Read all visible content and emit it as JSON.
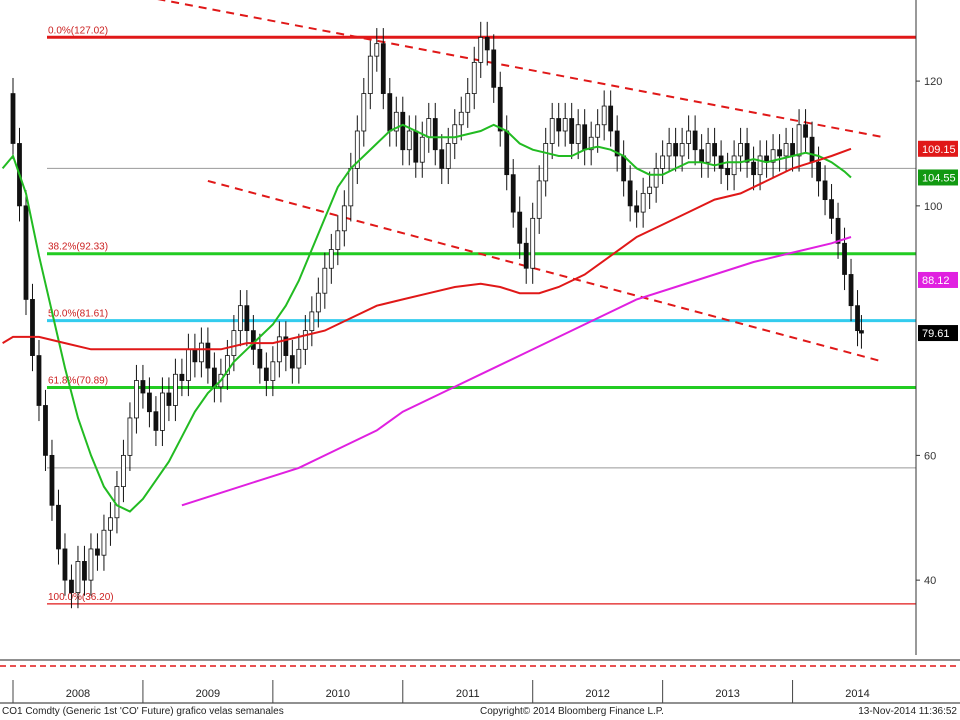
{
  "chart_data": {
    "type": "candlestick",
    "ylim": [
      28,
      133
    ],
    "x_range": [
      2007.9,
      2014.95
    ],
    "y_ticks": [
      "120",
      "100",
      "60",
      "40"
    ],
    "x_ticks": [
      "2008",
      "2009",
      "2010",
      "2011",
      "2012",
      "2013",
      "2014"
    ],
    "fib_levels": [
      {
        "label": "0.0%(127.02)",
        "value": 127.02,
        "color": "#e01818"
      },
      {
        "label": "38.2%(92.33)",
        "value": 92.33,
        "color": "#22cc22"
      },
      {
        "label": "50.0%(81.61)",
        "value": 81.61,
        "color": "#33ccee"
      },
      {
        "label": "61.8%(70.89)",
        "value": 70.89,
        "color": "#22cc22"
      },
      {
        "label": "100.0%(36.20)",
        "value": 36.2,
        "color": "#e01818"
      }
    ],
    "gray_lines": [
      106.0,
      58.0
    ],
    "price_path": [
      [
        2007.92,
        118
      ],
      [
        2008.0,
        110
      ],
      [
        2008.05,
        100
      ],
      [
        2008.1,
        85
      ],
      [
        2008.15,
        76
      ],
      [
        2008.2,
        68
      ],
      [
        2008.25,
        60
      ],
      [
        2008.3,
        52
      ],
      [
        2008.35,
        45
      ],
      [
        2008.4,
        40
      ],
      [
        2008.45,
        38
      ],
      [
        2008.5,
        43
      ],
      [
        2008.55,
        40
      ],
      [
        2008.6,
        45
      ],
      [
        2008.65,
        44
      ],
      [
        2008.7,
        48
      ],
      [
        2008.75,
        50
      ],
      [
        2008.8,
        55
      ],
      [
        2008.85,
        60
      ],
      [
        2008.9,
        66
      ],
      [
        2008.95,
        72
      ],
      [
        2009.0,
        70
      ],
      [
        2009.05,
        67
      ],
      [
        2009.1,
        64
      ],
      [
        2009.15,
        70
      ],
      [
        2009.2,
        68
      ],
      [
        2009.25,
        73
      ],
      [
        2009.3,
        72
      ],
      [
        2009.35,
        77
      ],
      [
        2009.4,
        75
      ],
      [
        2009.45,
        78
      ],
      [
        2009.5,
        74
      ],
      [
        2009.55,
        71
      ],
      [
        2009.6,
        73
      ],
      [
        2009.65,
        76
      ],
      [
        2009.7,
        80
      ],
      [
        2009.75,
        84
      ],
      [
        2009.8,
        80
      ],
      [
        2009.85,
        77
      ],
      [
        2009.9,
        74
      ],
      [
        2009.95,
        72
      ],
      [
        2010.0,
        75
      ],
      [
        2010.05,
        79
      ],
      [
        2010.1,
        76
      ],
      [
        2010.15,
        74
      ],
      [
        2010.2,
        77
      ],
      [
        2010.25,
        80
      ],
      [
        2010.3,
        83
      ],
      [
        2010.35,
        86
      ],
      [
        2010.4,
        90
      ],
      [
        2010.45,
        93
      ],
      [
        2010.5,
        96
      ],
      [
        2010.55,
        100
      ],
      [
        2010.6,
        106
      ],
      [
        2010.65,
        112
      ],
      [
        2010.7,
        118
      ],
      [
        2010.75,
        124
      ],
      [
        2010.8,
        126
      ],
      [
        2010.85,
        118
      ],
      [
        2010.9,
        112
      ],
      [
        2010.95,
        115
      ],
      [
        2011.0,
        109
      ],
      [
        2011.05,
        112
      ],
      [
        2011.1,
        107
      ],
      [
        2011.15,
        111
      ],
      [
        2011.2,
        114
      ],
      [
        2011.25,
        109
      ],
      [
        2011.3,
        106
      ],
      [
        2011.35,
        110
      ],
      [
        2011.4,
        113
      ],
      [
        2011.45,
        115
      ],
      [
        2011.5,
        118
      ],
      [
        2011.55,
        123
      ],
      [
        2011.6,
        127
      ],
      [
        2011.65,
        125
      ],
      [
        2011.7,
        119
      ],
      [
        2011.75,
        112
      ],
      [
        2011.8,
        105
      ],
      [
        2011.85,
        99
      ],
      [
        2011.9,
        94
      ],
      [
        2011.95,
        90
      ],
      [
        2012.0,
        98
      ],
      [
        2012.05,
        104
      ],
      [
        2012.1,
        110
      ],
      [
        2012.15,
        114
      ],
      [
        2012.2,
        112
      ],
      [
        2012.25,
        114
      ],
      [
        2012.3,
        110
      ],
      [
        2012.35,
        113
      ],
      [
        2012.4,
        109
      ],
      [
        2012.45,
        111
      ],
      [
        2012.5,
        113
      ],
      [
        2012.55,
        116
      ],
      [
        2012.6,
        112
      ],
      [
        2012.65,
        108
      ],
      [
        2012.7,
        104
      ],
      [
        2012.75,
        100
      ],
      [
        2012.8,
        99
      ],
      [
        2012.85,
        102
      ],
      [
        2012.9,
        103
      ],
      [
        2012.95,
        106
      ],
      [
        2013.0,
        108
      ],
      [
        2013.05,
        110
      ],
      [
        2013.1,
        108
      ],
      [
        2013.15,
        110
      ],
      [
        2013.2,
        112
      ],
      [
        2013.25,
        109
      ],
      [
        2013.3,
        107
      ],
      [
        2013.35,
        110
      ],
      [
        2013.4,
        108
      ],
      [
        2013.45,
        106
      ],
      [
        2013.5,
        105
      ],
      [
        2013.55,
        108
      ],
      [
        2013.6,
        110
      ],
      [
        2013.65,
        107
      ],
      [
        2013.7,
        105
      ],
      [
        2013.75,
        108
      ],
      [
        2013.8,
        107
      ],
      [
        2013.85,
        109
      ],
      [
        2013.9,
        108
      ],
      [
        2013.95,
        110
      ],
      [
        2014.0,
        108
      ],
      [
        2014.05,
        113
      ],
      [
        2014.1,
        111
      ],
      [
        2014.15,
        107
      ],
      [
        2014.2,
        104
      ],
      [
        2014.25,
        101
      ],
      [
        2014.3,
        98
      ],
      [
        2014.35,
        94
      ],
      [
        2014.4,
        89
      ],
      [
        2014.45,
        84
      ],
      [
        2014.5,
        80
      ],
      [
        2014.53,
        79.61
      ]
    ],
    "moving_averages": [
      {
        "color": "#22bb22",
        "values": [
          [
            2007.92,
            106
          ],
          [
            2008.0,
            108
          ],
          [
            2008.1,
            102
          ],
          [
            2008.2,
            92
          ],
          [
            2008.3,
            83
          ],
          [
            2008.4,
            74
          ],
          [
            2008.5,
            66
          ],
          [
            2008.6,
            60
          ],
          [
            2008.7,
            55
          ],
          [
            2008.8,
            52
          ],
          [
            2008.9,
            51
          ],
          [
            2009.0,
            53
          ],
          [
            2009.1,
            56
          ],
          [
            2009.2,
            59
          ],
          [
            2009.3,
            63
          ],
          [
            2009.4,
            67
          ],
          [
            2009.5,
            70
          ],
          [
            2009.6,
            72
          ],
          [
            2009.7,
            75
          ],
          [
            2009.8,
            77
          ],
          [
            2009.9,
            79
          ],
          [
            2010.0,
            81
          ],
          [
            2010.1,
            84
          ],
          [
            2010.2,
            88
          ],
          [
            2010.3,
            93
          ],
          [
            2010.4,
            98
          ],
          [
            2010.5,
            103
          ],
          [
            2010.6,
            106
          ],
          [
            2010.7,
            108
          ],
          [
            2010.8,
            110
          ],
          [
            2010.9,
            112
          ],
          [
            2011.0,
            113
          ],
          [
            2011.1,
            112
          ],
          [
            2011.2,
            111
          ],
          [
            2011.3,
            111
          ],
          [
            2011.4,
            111
          ],
          [
            2011.5,
            111.5
          ],
          [
            2011.6,
            112
          ],
          [
            2011.7,
            113
          ],
          [
            2011.8,
            112
          ],
          [
            2011.9,
            110
          ],
          [
            2012.0,
            109
          ],
          [
            2012.1,
            108.5
          ],
          [
            2012.2,
            108
          ],
          [
            2012.3,
            108
          ],
          [
            2012.4,
            109
          ],
          [
            2012.5,
            109.5
          ],
          [
            2012.6,
            109
          ],
          [
            2012.7,
            108
          ],
          [
            2012.8,
            106
          ],
          [
            2012.9,
            105
          ],
          [
            2013.0,
            105
          ],
          [
            2013.1,
            106
          ],
          [
            2013.2,
            107
          ],
          [
            2013.3,
            107
          ],
          [
            2013.4,
            106.5
          ],
          [
            2013.5,
            107
          ],
          [
            2013.6,
            107
          ],
          [
            2013.7,
            107.5
          ],
          [
            2013.8,
            107
          ],
          [
            2013.9,
            107.5
          ],
          [
            2014.0,
            108
          ],
          [
            2014.1,
            108.5
          ],
          [
            2014.2,
            108
          ],
          [
            2014.3,
            107
          ],
          [
            2014.4,
            105.5
          ],
          [
            2014.45,
            104.55
          ]
        ]
      },
      {
        "color": "#e01818",
        "values": [
          [
            2007.92,
            78
          ],
          [
            2008.0,
            79
          ],
          [
            2008.2,
            79
          ],
          [
            2008.4,
            78
          ],
          [
            2008.6,
            77
          ],
          [
            2008.8,
            77
          ],
          [
            2009.0,
            77
          ],
          [
            2009.2,
            77
          ],
          [
            2009.4,
            77
          ],
          [
            2009.6,
            77
          ],
          [
            2009.8,
            78
          ],
          [
            2010.0,
            78
          ],
          [
            2010.2,
            79
          ],
          [
            2010.4,
            80
          ],
          [
            2010.6,
            82
          ],
          [
            2010.8,
            84
          ],
          [
            2011.0,
            85
          ],
          [
            2011.2,
            86
          ],
          [
            2011.4,
            87
          ],
          [
            2011.6,
            87.5
          ],
          [
            2011.75,
            87
          ],
          [
            2011.9,
            86
          ],
          [
            2012.05,
            86
          ],
          [
            2012.2,
            87
          ],
          [
            2012.4,
            89
          ],
          [
            2012.6,
            92
          ],
          [
            2012.8,
            95
          ],
          [
            2013.0,
            97
          ],
          [
            2013.2,
            99
          ],
          [
            2013.4,
            101
          ],
          [
            2013.6,
            102
          ],
          [
            2013.8,
            104
          ],
          [
            2014.0,
            106
          ],
          [
            2014.15,
            107
          ],
          [
            2014.3,
            108
          ],
          [
            2014.45,
            109.15
          ]
        ]
      },
      {
        "color": "#e020e0",
        "values": [
          [
            2009.3,
            52
          ],
          [
            2009.6,
            54
          ],
          [
            2009.9,
            56
          ],
          [
            2010.2,
            58
          ],
          [
            2010.5,
            61
          ],
          [
            2010.8,
            64
          ],
          [
            2011.0,
            67
          ],
          [
            2011.3,
            70
          ],
          [
            2011.6,
            73
          ],
          [
            2011.9,
            76
          ],
          [
            2012.2,
            79
          ],
          [
            2012.5,
            82
          ],
          [
            2012.8,
            85
          ],
          [
            2013.1,
            87
          ],
          [
            2013.4,
            89
          ],
          [
            2013.7,
            91
          ],
          [
            2014.0,
            92.5
          ],
          [
            2014.3,
            94
          ],
          [
            2014.45,
            95
          ]
        ]
      }
    ],
    "trendlines": [
      {
        "color": "#e01818",
        "points": [
          [
            2008.9,
            134
          ],
          [
            2014.7,
            111
          ]
        ]
      },
      {
        "color": "#e01818",
        "points": [
          [
            2009.5,
            104
          ],
          [
            2014.7,
            75
          ]
        ]
      }
    ],
    "price_tags": [
      {
        "label": "109.15",
        "value": 109.15,
        "bg": "#e01818",
        "fg": "#ffffff"
      },
      {
        "label": "104.55",
        "value": 104.55,
        "bg": "#119911",
        "fg": "#ffffff"
      },
      {
        "label": "88.12",
        "value": 88.12,
        "bg": "#e020e0",
        "fg": "#ffffff"
      },
      {
        "label": "79.61",
        "value": 79.61,
        "bg": "#000000",
        "fg": "#ffffff"
      }
    ]
  },
  "footer": {
    "left": "CO1 Comdty (Generic 1st 'CO' Future) grafico velas semanales",
    "center": "Copyright© 2014 Bloomberg Finance L.P.",
    "right": "13-Nov-2014 11:36:52"
  }
}
